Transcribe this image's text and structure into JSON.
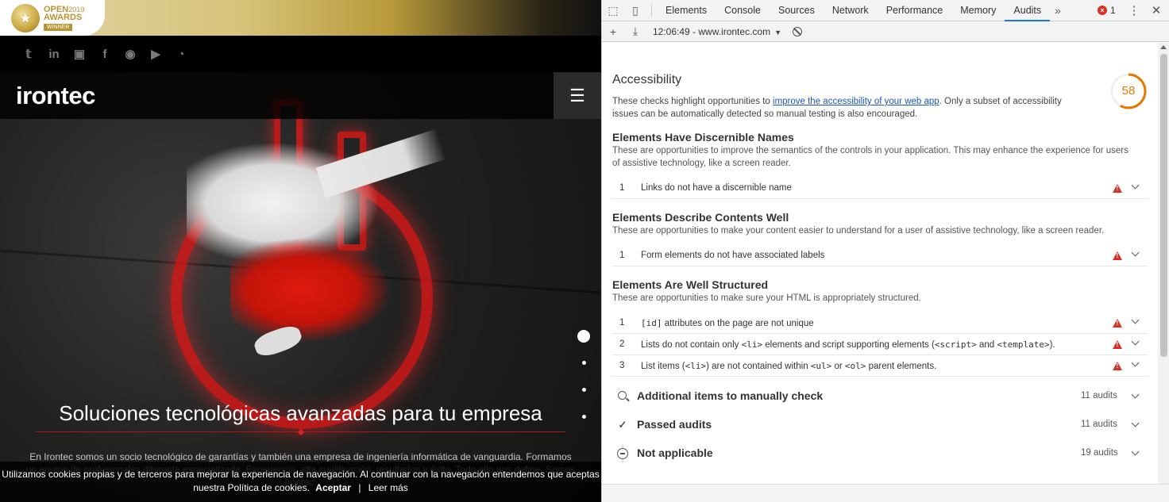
{
  "site": {
    "award": {
      "line1": "OPEN",
      "year": "2019",
      "line2": "AWARDS",
      "line3": "WINNER"
    },
    "social_icons": [
      "twitter-icon",
      "linkedin-icon",
      "slideshare-icon",
      "facebook-icon",
      "github-icon",
      "youtube-icon",
      "rss-icon"
    ],
    "logo": "irontec",
    "tagline": "Soluciones tecnológicas avanzadas para tu empresa",
    "intro": "En Irontec somos un socio tecnológico de garantías y también una empresa de ingeniería informática de vanguardia. Formamos un equipo de profesionales diferente especializado. Experiencia, alta cualificación, resultados y éxito. Todo ello nos define. Somos Irontec.",
    "cookie": {
      "text": "Utilizamos cookies propias y de terceros para mejorar la experiencia de navegación. Al continuar con la navegación entendemos que aceptas nuestra Política de cookies.",
      "accept": "Aceptar",
      "separator": "|",
      "more": "Leer más"
    }
  },
  "devtools": {
    "tabs": [
      "Elements",
      "Console",
      "Sources",
      "Network",
      "Performance",
      "Memory",
      "Audits"
    ],
    "active_tab": "Audits",
    "more_tabs": "»",
    "error_count": "1",
    "report_selector": "12:06:49 - www.irontec.com",
    "accessibility": {
      "title": "Accessibility",
      "desc_pre": "These checks highlight opportunities to ",
      "desc_link": "improve the accessibility of your web app",
      "desc_post": ". Only a subset of accessibility issues can be automatically detected so manual testing is also encouraged.",
      "score": "58",
      "score_fraction": 0.58,
      "score_color": "#e67700"
    },
    "groups": [
      {
        "title": "Elements Have Discernible Names",
        "desc": "These are opportunities to improve the semantics of the controls in your application. This may enhance the experience for users of assistive technology, like a screen reader.",
        "audits": [
          {
            "num": "1",
            "title": "Links do not have a discernible name"
          }
        ]
      },
      {
        "title": "Elements Describe Contents Well",
        "desc": "These are opportunities to make your content easier to understand for a user of assistive technology, like a screen reader.",
        "audits": [
          {
            "num": "1",
            "title": "Form elements do not have associated labels"
          }
        ]
      },
      {
        "title": "Elements Are Well Structured",
        "desc": "These are opportunities to make sure your HTML is appropriately structured.",
        "audits": [
          {
            "num": "1",
            "parts": [
              "[id]",
              " attributes on the page are not unique"
            ]
          },
          {
            "num": "2",
            "parts": [
              "Lists do not contain only ",
              "<li>",
              " elements and script supporting elements (",
              "<script>",
              " and ",
              "<template>",
              ")."
            ]
          },
          {
            "num": "3",
            "parts": [
              "List items (",
              "<li>",
              ") are not contained within ",
              "<ul>",
              " or ",
              "<ol>",
              " parent elements."
            ]
          }
        ]
      }
    ],
    "sections": [
      {
        "title": "Additional items to manually check",
        "count": "11 audits"
      },
      {
        "title": "Passed audits",
        "count": "11 audits"
      },
      {
        "title": "Not applicable",
        "count": "19 audits"
      }
    ]
  }
}
